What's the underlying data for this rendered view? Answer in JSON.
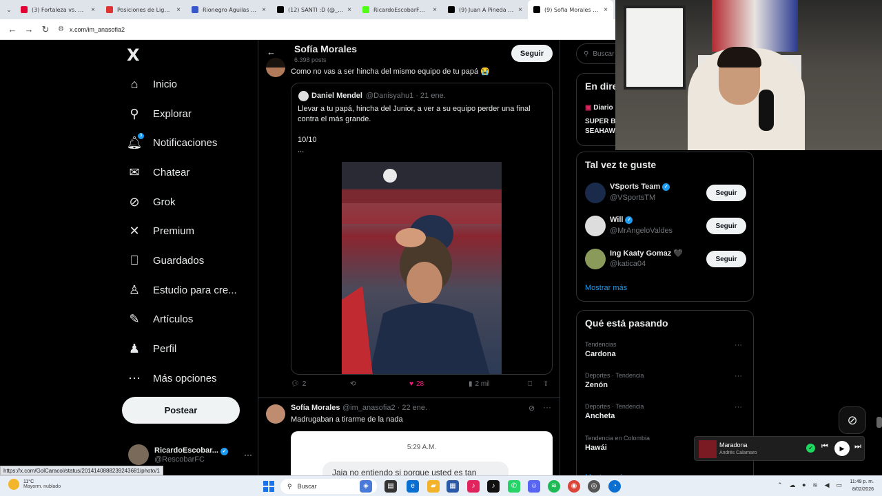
{
  "browser": {
    "tabs": [
      {
        "title": "(3) Fortaleza vs. Santa",
        "fav_color": "#e00033"
      },
      {
        "title": "Posiciones de Liga D...",
        "fav_color": "#d33"
      },
      {
        "title": "Rionegro Águilas Do...",
        "fav_color": "#3857c8"
      },
      {
        "title": "(12) SANTI :D (@_A...",
        "fav_color": "#000"
      },
      {
        "title": "RicardoEscobarFC Str...",
        "fav_color": "#53fc18"
      },
      {
        "title": "(9) Juan A Pineda M...",
        "fav_color": "#000"
      },
      {
        "title": "(9) Sofia Morales (@...",
        "fav_color": "#000"
      }
    ],
    "url": "x.com/im_anasofia2"
  },
  "nav": {
    "logo": "X",
    "items": [
      {
        "label": "Inicio",
        "icon": "home-icon"
      },
      {
        "label": "Explorar",
        "icon": "search-icon"
      },
      {
        "label": "Notificaciones",
        "icon": "bell-icon",
        "badge": "3"
      },
      {
        "label": "Chatear",
        "icon": "mail-icon"
      },
      {
        "label": "Grok",
        "icon": "grok-icon"
      },
      {
        "label": "Premium",
        "icon": "x-premium-icon"
      },
      {
        "label": "Guardados",
        "icon": "bookmark-icon"
      },
      {
        "label": "Estudio para cre...",
        "icon": "creator-studio-icon"
      },
      {
        "label": "Artículos",
        "icon": "articles-icon"
      },
      {
        "label": "Perfil",
        "icon": "person-icon"
      },
      {
        "label": "Más opciones",
        "icon": "more-circle-icon"
      }
    ],
    "post_button": "Postear",
    "account": {
      "name": "RicardoEscobar...",
      "handle": "@RescobarFC"
    }
  },
  "profile": {
    "name": "Sofía Morales",
    "posts": "6.398 posts",
    "follow": "Seguir"
  },
  "tweet1": {
    "text": "Como no vas a ser hincha del mismo equipo de tu papá 😭",
    "quote": {
      "name": "Daniel Mendel",
      "handle": "@Danisyahu1 · 21 ene.",
      "lines": [
        "Llevar a tu papá, hincha del Junior, a ver a su equipo perder una final",
        "contra el más grande.",
        "",
        "10/10",
        "..."
      ]
    },
    "actions": {
      "replies": "2",
      "retweets": "",
      "likes": "28",
      "views": "2 mil"
    }
  },
  "tweet2": {
    "name": "Sofía Morales",
    "handle": "@im_anasofia2 · 22 ene.",
    "text": "Madrugaban a tirarme de la nada",
    "chat_time": "5:29 A.M.",
    "chat_message": "Jaja no entiendo si porque usted es tan"
  },
  "right": {
    "search_placeholder": "Buscar",
    "live": {
      "title": "En dire",
      "source": "Diario",
      "line1": "SUPER B",
      "line2": "SEAHAW"
    },
    "suggestions_title": "Tal vez te guste",
    "suggestions": [
      {
        "name": "VSports Team",
        "handle": "@VSportsTM",
        "verified": true,
        "avatar_color": "#1a2a4a"
      },
      {
        "name": "Will",
        "handle": "@MrAngeloValdes",
        "verified": true,
        "avatar_color": "#ddd"
      },
      {
        "name": "Ing Kaaty Gomaz 🖤",
        "handle": "@katica04",
        "verified": false,
        "avatar_color": "#8a9a5a"
      }
    ],
    "follow_label": "Seguir",
    "show_more": "Mostrar más",
    "trends_title": "Qué está pasando",
    "trends": [
      {
        "category": "Tendencias",
        "topic": "Cardona"
      },
      {
        "category": "Deportes · Tendencia",
        "topic": "Zenón"
      },
      {
        "category": "Deportes · Tendencia",
        "topic": "Ancheta"
      },
      {
        "category": "Tendencia en Colombia",
        "topic": "Hawái"
      }
    ]
  },
  "status_link": "https://x.com/GolCaracol/status/2014140888239243681/photo/1",
  "music": {
    "title": "Maradona",
    "artist": "Andrés Calamaro"
  },
  "taskbar": {
    "temp": "11°C",
    "condition": "Mayorm. nublado",
    "search": "Buscar",
    "time": "11:49 p. m.",
    "date": "8/02/2026"
  }
}
